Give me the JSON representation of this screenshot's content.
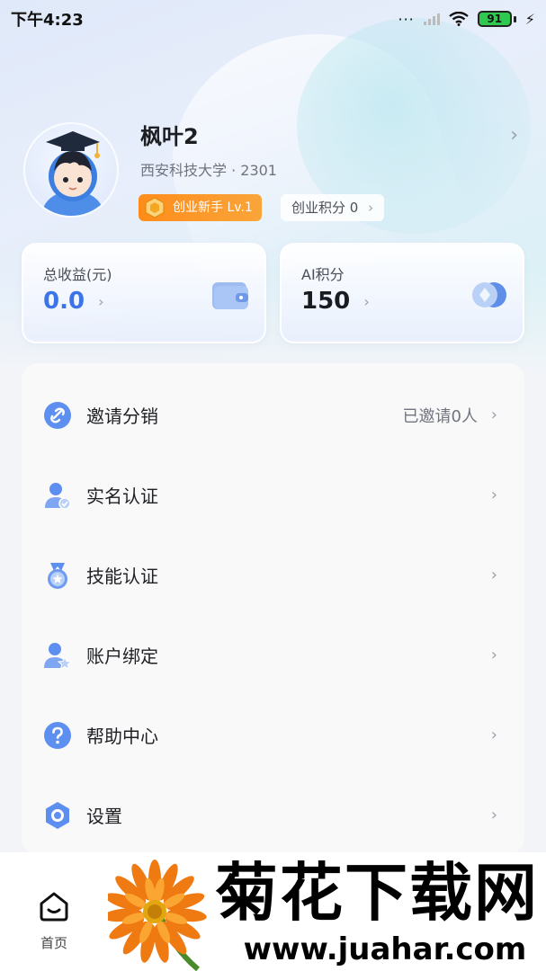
{
  "status_bar": {
    "time": "下午4:23",
    "dots": "···",
    "battery": "91"
  },
  "profile": {
    "name": "枫叶2",
    "school": "西安科技大学 · 2301",
    "level_badge": "创业新手 Lv.1",
    "points_badge": "创业积分 0",
    "arrow": "›"
  },
  "cards": {
    "earnings": {
      "label": "总收益(元)",
      "value": "0.0",
      "arrow": "›",
      "icon": "wallet-icon"
    },
    "ai_points": {
      "label": "AI积分",
      "value": "150",
      "arrow": "›",
      "icon": "coin-stack-icon"
    }
  },
  "menu": {
    "items": [
      {
        "label": "邀请分销",
        "value": "已邀请0人",
        "icon": "link-icon",
        "arrow": "›"
      },
      {
        "label": "实名认证",
        "value": "",
        "icon": "verified-user-icon",
        "arrow": "›"
      },
      {
        "label": "技能认证",
        "value": "",
        "icon": "medal-icon",
        "arrow": "›"
      },
      {
        "label": "账户绑定",
        "value": "",
        "icon": "user-star-icon",
        "arrow": "›"
      },
      {
        "label": "帮助中心",
        "value": "",
        "icon": "help-icon",
        "arrow": "›"
      },
      {
        "label": "设置",
        "value": "",
        "icon": "settings-hex-icon",
        "arrow": "›"
      }
    ]
  },
  "tabbar": {
    "home_label": "首页",
    "home_icon": "home-smile-icon"
  },
  "watermark": {
    "title": "菊花下载网",
    "url": "www.juahar.com"
  },
  "colors": {
    "accent": "#3b73e8",
    "badge_orange": "#ff8c1a",
    "battery_green": "#30c94f"
  }
}
